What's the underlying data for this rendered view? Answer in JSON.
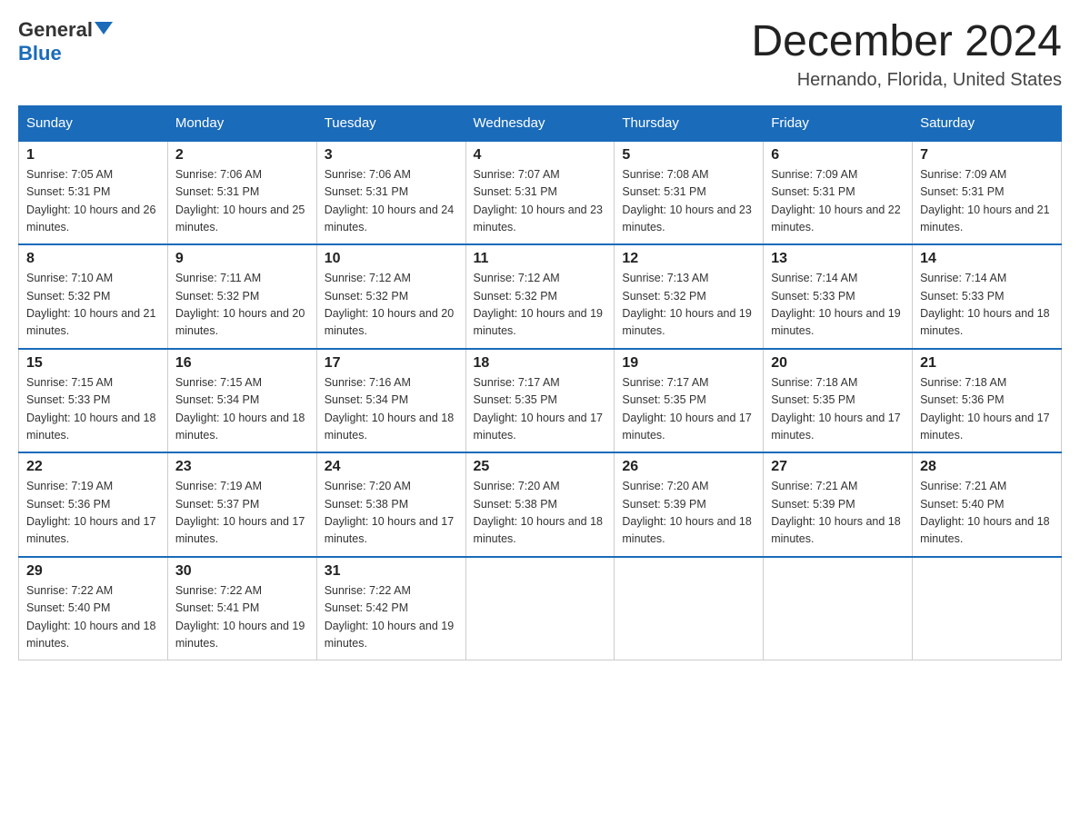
{
  "header": {
    "logo_general": "General",
    "logo_blue": "Blue",
    "month_title": "December 2024",
    "location": "Hernando, Florida, United States"
  },
  "weekdays": [
    "Sunday",
    "Monday",
    "Tuesday",
    "Wednesday",
    "Thursday",
    "Friday",
    "Saturday"
  ],
  "weeks": [
    [
      {
        "day": "1",
        "sunrise": "7:05 AM",
        "sunset": "5:31 PM",
        "daylight": "10 hours and 26 minutes."
      },
      {
        "day": "2",
        "sunrise": "7:06 AM",
        "sunset": "5:31 PM",
        "daylight": "10 hours and 25 minutes."
      },
      {
        "day": "3",
        "sunrise": "7:06 AM",
        "sunset": "5:31 PM",
        "daylight": "10 hours and 24 minutes."
      },
      {
        "day": "4",
        "sunrise": "7:07 AM",
        "sunset": "5:31 PM",
        "daylight": "10 hours and 23 minutes."
      },
      {
        "day": "5",
        "sunrise": "7:08 AM",
        "sunset": "5:31 PM",
        "daylight": "10 hours and 23 minutes."
      },
      {
        "day": "6",
        "sunrise": "7:09 AM",
        "sunset": "5:31 PM",
        "daylight": "10 hours and 22 minutes."
      },
      {
        "day": "7",
        "sunrise": "7:09 AM",
        "sunset": "5:31 PM",
        "daylight": "10 hours and 21 minutes."
      }
    ],
    [
      {
        "day": "8",
        "sunrise": "7:10 AM",
        "sunset": "5:32 PM",
        "daylight": "10 hours and 21 minutes."
      },
      {
        "day": "9",
        "sunrise": "7:11 AM",
        "sunset": "5:32 PM",
        "daylight": "10 hours and 20 minutes."
      },
      {
        "day": "10",
        "sunrise": "7:12 AM",
        "sunset": "5:32 PM",
        "daylight": "10 hours and 20 minutes."
      },
      {
        "day": "11",
        "sunrise": "7:12 AM",
        "sunset": "5:32 PM",
        "daylight": "10 hours and 19 minutes."
      },
      {
        "day": "12",
        "sunrise": "7:13 AM",
        "sunset": "5:32 PM",
        "daylight": "10 hours and 19 minutes."
      },
      {
        "day": "13",
        "sunrise": "7:14 AM",
        "sunset": "5:33 PM",
        "daylight": "10 hours and 19 minutes."
      },
      {
        "day": "14",
        "sunrise": "7:14 AM",
        "sunset": "5:33 PM",
        "daylight": "10 hours and 18 minutes."
      }
    ],
    [
      {
        "day": "15",
        "sunrise": "7:15 AM",
        "sunset": "5:33 PM",
        "daylight": "10 hours and 18 minutes."
      },
      {
        "day": "16",
        "sunrise": "7:15 AM",
        "sunset": "5:34 PM",
        "daylight": "10 hours and 18 minutes."
      },
      {
        "day": "17",
        "sunrise": "7:16 AM",
        "sunset": "5:34 PM",
        "daylight": "10 hours and 18 minutes."
      },
      {
        "day": "18",
        "sunrise": "7:17 AM",
        "sunset": "5:35 PM",
        "daylight": "10 hours and 17 minutes."
      },
      {
        "day": "19",
        "sunrise": "7:17 AM",
        "sunset": "5:35 PM",
        "daylight": "10 hours and 17 minutes."
      },
      {
        "day": "20",
        "sunrise": "7:18 AM",
        "sunset": "5:35 PM",
        "daylight": "10 hours and 17 minutes."
      },
      {
        "day": "21",
        "sunrise": "7:18 AM",
        "sunset": "5:36 PM",
        "daylight": "10 hours and 17 minutes."
      }
    ],
    [
      {
        "day": "22",
        "sunrise": "7:19 AM",
        "sunset": "5:36 PM",
        "daylight": "10 hours and 17 minutes."
      },
      {
        "day": "23",
        "sunrise": "7:19 AM",
        "sunset": "5:37 PM",
        "daylight": "10 hours and 17 minutes."
      },
      {
        "day": "24",
        "sunrise": "7:20 AM",
        "sunset": "5:38 PM",
        "daylight": "10 hours and 17 minutes."
      },
      {
        "day": "25",
        "sunrise": "7:20 AM",
        "sunset": "5:38 PM",
        "daylight": "10 hours and 18 minutes."
      },
      {
        "day": "26",
        "sunrise": "7:20 AM",
        "sunset": "5:39 PM",
        "daylight": "10 hours and 18 minutes."
      },
      {
        "day": "27",
        "sunrise": "7:21 AM",
        "sunset": "5:39 PM",
        "daylight": "10 hours and 18 minutes."
      },
      {
        "day": "28",
        "sunrise": "7:21 AM",
        "sunset": "5:40 PM",
        "daylight": "10 hours and 18 minutes."
      }
    ],
    [
      {
        "day": "29",
        "sunrise": "7:22 AM",
        "sunset": "5:40 PM",
        "daylight": "10 hours and 18 minutes."
      },
      {
        "day": "30",
        "sunrise": "7:22 AM",
        "sunset": "5:41 PM",
        "daylight": "10 hours and 19 minutes."
      },
      {
        "day": "31",
        "sunrise": "7:22 AM",
        "sunset": "5:42 PM",
        "daylight": "10 hours and 19 minutes."
      },
      null,
      null,
      null,
      null
    ]
  ],
  "labels": {
    "sunrise_prefix": "Sunrise: ",
    "sunset_prefix": "Sunset: ",
    "daylight_prefix": "Daylight: "
  }
}
